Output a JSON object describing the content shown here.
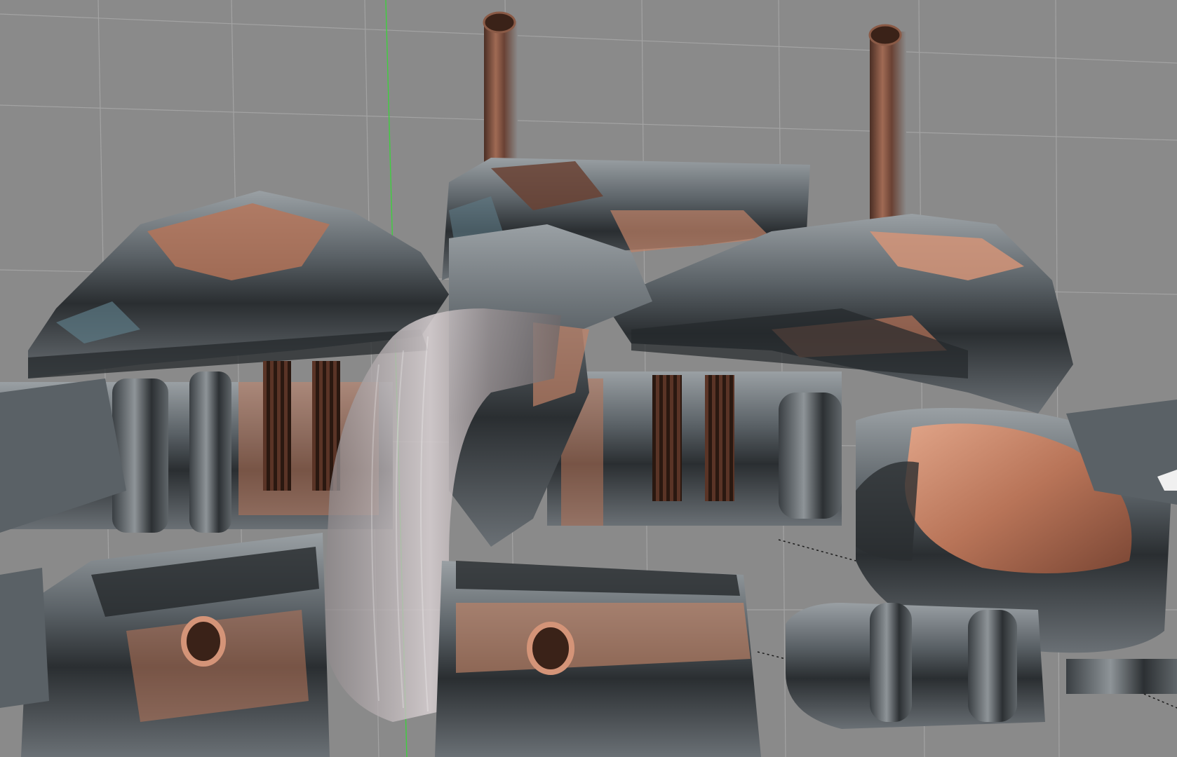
{
  "viewport": {
    "background_color": "#8a8a8a",
    "grid_color": "#a3a3a3",
    "axis_y_color": "#3fcf3f",
    "grid_visible": true,
    "shading_mode": "textured",
    "model": {
      "material_colors": {
        "copper": "#b87458",
        "copper_light": "#d49478",
        "steel": "#4e555a",
        "steel_dark": "#24282b",
        "steel_light": "#8f9599",
        "patina_blue": "#5d7a86",
        "translucent_tube": "#b6adb0"
      }
    }
  }
}
